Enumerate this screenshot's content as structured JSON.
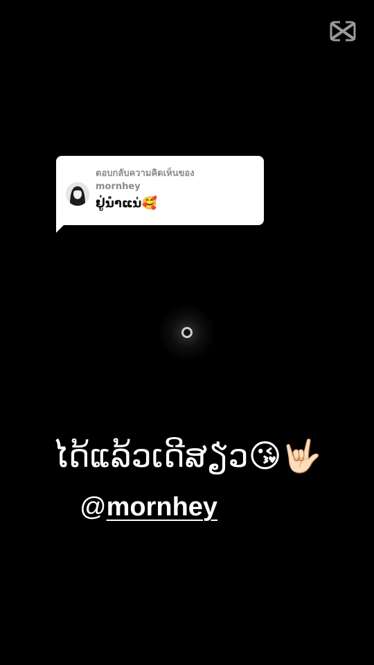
{
  "logo": {
    "icon": "capcut-logo-icon"
  },
  "reply_bubble": {
    "header_line1": "ตอบกลับความคิดเห็นของ",
    "header_line2": "mornhey",
    "comment": "ຢູ່ນຳແນ່🥰",
    "avatar_icon": "user-avatar"
  },
  "spinner": {
    "icon": "loading-spinner-icon"
  },
  "caption": {
    "text": "ໄດ້ແລ້ວເດີສຽ່ວ😘🤟🏻",
    "at": "@",
    "handle": "mornhey"
  },
  "colors": {
    "background": "#000000",
    "bubble": "#ffffff",
    "header_text": "#8a8a8a"
  }
}
